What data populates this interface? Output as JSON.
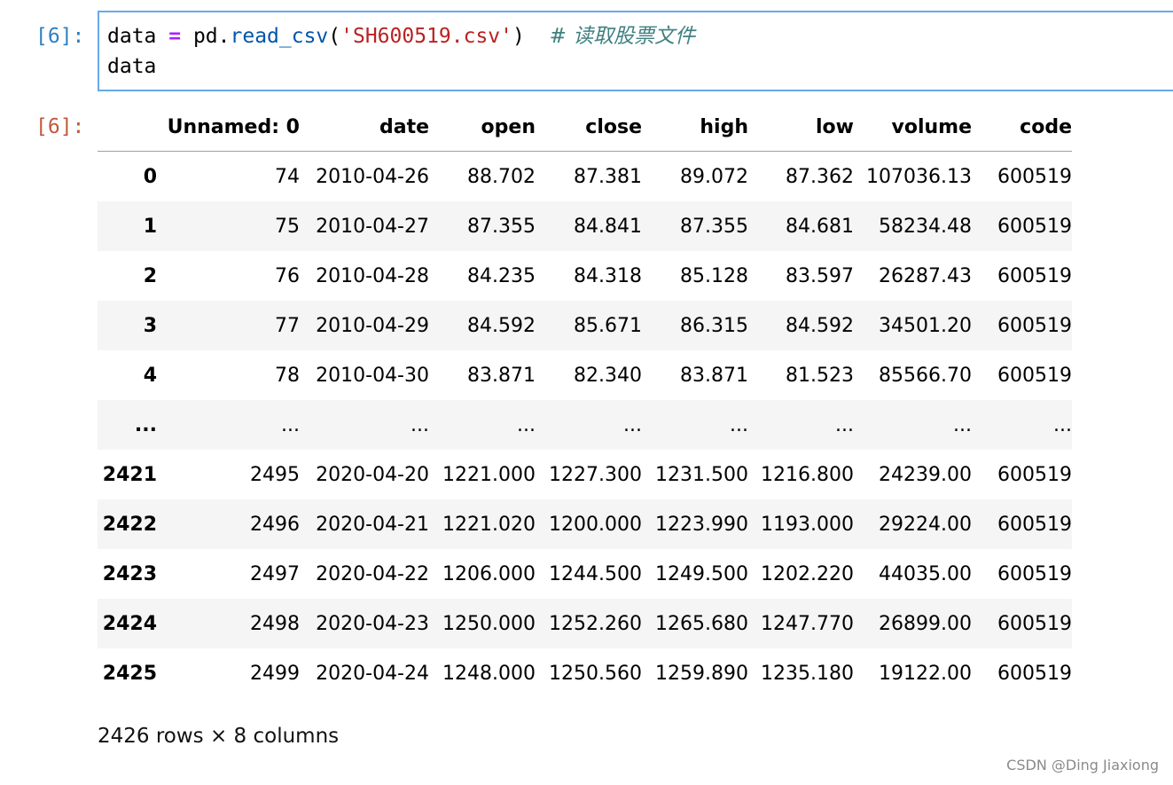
{
  "input_cell": {
    "prompt": "[6]:",
    "code": {
      "line1": {
        "var": "data ",
        "op": "=",
        "mid": " pd.",
        "func": "read_csv",
        "open": "(",
        "str": "'SH600519.csv'",
        "close": ")  ",
        "comment": "# 读取股票文件"
      },
      "line2": "data"
    }
  },
  "output_cell": {
    "prompt": "[6]:",
    "table": {
      "columns": [
        "",
        "Unnamed: 0",
        "date",
        "open",
        "close",
        "high",
        "low",
        "volume",
        "code"
      ],
      "rows": [
        [
          "0",
          "74",
          "2010-04-26",
          "88.702",
          "87.381",
          "89.072",
          "87.362",
          "107036.13",
          "600519"
        ],
        [
          "1",
          "75",
          "2010-04-27",
          "87.355",
          "84.841",
          "87.355",
          "84.681",
          "58234.48",
          "600519"
        ],
        [
          "2",
          "76",
          "2010-04-28",
          "84.235",
          "84.318",
          "85.128",
          "83.597",
          "26287.43",
          "600519"
        ],
        [
          "3",
          "77",
          "2010-04-29",
          "84.592",
          "85.671",
          "86.315",
          "84.592",
          "34501.20",
          "600519"
        ],
        [
          "4",
          "78",
          "2010-04-30",
          "83.871",
          "82.340",
          "83.871",
          "81.523",
          "85566.70",
          "600519"
        ],
        [
          "...",
          "...",
          "...",
          "...",
          "...",
          "...",
          "...",
          "...",
          "..."
        ],
        [
          "2421",
          "2495",
          "2020-04-20",
          "1221.000",
          "1227.300",
          "1231.500",
          "1216.800",
          "24239.00",
          "600519"
        ],
        [
          "2422",
          "2496",
          "2020-04-21",
          "1221.020",
          "1200.000",
          "1223.990",
          "1193.000",
          "29224.00",
          "600519"
        ],
        [
          "2423",
          "2497",
          "2020-04-22",
          "1206.000",
          "1244.500",
          "1249.500",
          "1202.220",
          "44035.00",
          "600519"
        ],
        [
          "2424",
          "2498",
          "2020-04-23",
          "1250.000",
          "1252.260",
          "1265.680",
          "1247.770",
          "26899.00",
          "600519"
        ],
        [
          "2425",
          "2499",
          "2020-04-24",
          "1248.000",
          "1250.560",
          "1259.890",
          "1235.180",
          "19122.00",
          "600519"
        ]
      ]
    },
    "shape_text": "2426 rows × 8 columns"
  },
  "watermark": "CSDN @Ding Jiaxiong",
  "colors": {
    "in_prompt": "#307fc1",
    "out_prompt": "#bf5b3d",
    "cell_border": "#66a9e8",
    "string": "#ba2121",
    "keyword_op": "#aa22ff",
    "function": "#0055aa",
    "comment": "#408080",
    "stripe": "#f5f5f5"
  }
}
